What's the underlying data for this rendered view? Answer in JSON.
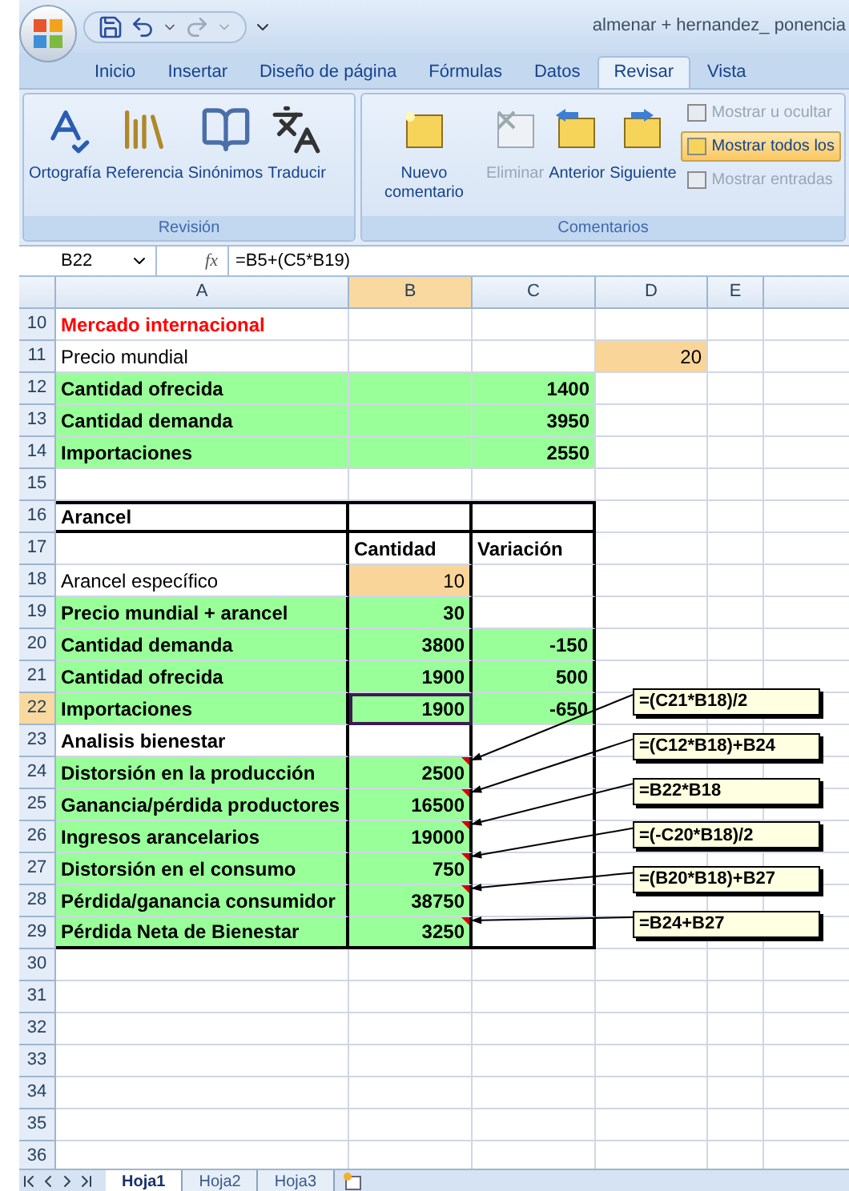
{
  "window": {
    "title": "almenar + hernandez_ ponencia"
  },
  "tabs": [
    {
      "label": "Inicio",
      "selected": false
    },
    {
      "label": "Insertar",
      "selected": false
    },
    {
      "label": "Diseño de página",
      "selected": false
    },
    {
      "label": "Fórmulas",
      "selected": false
    },
    {
      "label": "Datos",
      "selected": false
    },
    {
      "label": "Revisar",
      "selected": true
    },
    {
      "label": "Vista",
      "selected": false
    }
  ],
  "ribbon": {
    "groups": [
      {
        "label": "Revisión",
        "buttons": [
          {
            "kind": "spelling",
            "label": "Ortografía",
            "disabled": false
          },
          {
            "kind": "research",
            "label": "Referencia",
            "disabled": false
          },
          {
            "kind": "thesaurus",
            "label": "Sinónimos",
            "disabled": false
          },
          {
            "kind": "translate",
            "label": "Traducir",
            "disabled": false
          }
        ]
      },
      {
        "label": "Comentarios",
        "buttons": [
          {
            "kind": "new",
            "label": "Nuevo comentario",
            "disabled": false
          },
          {
            "kind": "delete",
            "label": "Eliminar",
            "disabled": true
          },
          {
            "kind": "previous",
            "label": "Anterior",
            "disabled": false
          },
          {
            "kind": "next",
            "label": "Siguiente",
            "disabled": false
          }
        ],
        "side_items": [
          {
            "label": "Mostrar u ocultar",
            "disabled": true,
            "on": false
          },
          {
            "label": "Mostrar todos los",
            "disabled": false,
            "on": true
          },
          {
            "label": "Mostrar entradas",
            "disabled": true,
            "on": false
          }
        ]
      }
    ]
  },
  "formula_bar": {
    "name_box": "B22",
    "fx": "fx",
    "formula": "=B5+(C5*B19)"
  },
  "columns": [
    {
      "label": "A",
      "selected": false
    },
    {
      "label": "B",
      "selected": true
    },
    {
      "label": "C",
      "selected": false
    },
    {
      "label": "D",
      "selected": false
    },
    {
      "label": "E",
      "selected": false
    }
  ],
  "rows": [
    {
      "number": "10",
      "selected": false,
      "kind": "section",
      "cells": [
        {
          "kind": "text",
          "text": "Mercado internacional"
        }
      ]
    },
    {
      "number": "11",
      "selected": false,
      "kind": "entry",
      "cells": [
        {
          "kind": "text",
          "text": "Precio mundial"
        },
        {},
        {},
        {
          "kind": "number",
          "text": "20",
          "color": "#fad59a"
        }
      ]
    },
    {
      "number": "12",
      "selected": false,
      "kind": "result",
      "cells": [
        {
          "kind": "text",
          "text": "Cantidad ofrecida",
          "color": "#99ff99"
        },
        {
          "kind": "number",
          "color": "#99ff99"
        },
        {
          "kind": "number",
          "text": "1400",
          "color": "#99ff99"
        }
      ]
    },
    {
      "number": "13",
      "selected": false,
      "kind": "result",
      "cells": [
        {
          "kind": "text",
          "text": "Cantidad demanda",
          "color": "#99ff99"
        },
        {
          "kind": "number",
          "color": "#99ff99"
        },
        {
          "kind": "number",
          "text": "3950",
          "color": "#99ff99"
        }
      ]
    },
    {
      "number": "14",
      "selected": false,
      "kind": "result",
      "cells": [
        {
          "kind": "text",
          "text": "Importaciones",
          "color": "#99ff99"
        },
        {
          "kind": "number",
          "color": "#99ff99"
        },
        {
          "kind": "number",
          "text": "2550",
          "color": "#99ff99"
        }
      ]
    },
    {
      "number": "15",
      "selected": false,
      "kind": "entry",
      "cells": []
    },
    {
      "number": "16",
      "selected": false,
      "kind": "result",
      "cells": [
        {
          "kind": "text",
          "text": "Arancel"
        }
      ]
    },
    {
      "number": "17",
      "selected": false,
      "kind": "result",
      "cells": [
        {},
        {
          "kind": "text",
          "text": "Cantidad"
        },
        {
          "kind": "text",
          "text": "Variación"
        }
      ]
    },
    {
      "number": "18",
      "selected": false,
      "kind": "entry",
      "cells": [
        {
          "kind": "text",
          "text": "Arancel específico"
        },
        {
          "kind": "number",
          "text": "10",
          "color": "#fad59a"
        }
      ]
    },
    {
      "number": "19",
      "selected": false,
      "kind": "result",
      "cells": [
        {
          "kind": "text",
          "text": "Precio mundial + arancel",
          "color": "#99ff99"
        },
        {
          "kind": "number",
          "text": "30",
          "color": "#99ff99"
        }
      ]
    },
    {
      "number": "20",
      "selected": false,
      "kind": "result",
      "cells": [
        {
          "kind": "text",
          "text": "Cantidad demanda",
          "color": "#99ff99"
        },
        {
          "kind": "number",
          "text": "3800",
          "color": "#99ff99"
        },
        {
          "kind": "number",
          "text": "-150",
          "color": "#99ff99"
        }
      ]
    },
    {
      "number": "21",
      "selected": false,
      "kind": "result",
      "cells": [
        {
          "kind": "text",
          "text": "Cantidad ofrecida",
          "color": "#99ff99"
        },
        {
          "kind": "number",
          "text": "1900",
          "color": "#99ff99"
        },
        {
          "kind": "number",
          "text": "500",
          "color": "#99ff99"
        }
      ]
    },
    {
      "number": "22",
      "selected": true,
      "kind": "result",
      "cells": [
        {
          "kind": "text",
          "text": "Importaciones",
          "color": "#99ff99"
        },
        {
          "kind": "number",
          "text": "1900",
          "color": "#99ff99"
        },
        {
          "kind": "number",
          "text": "-650",
          "color": "#99ff99"
        }
      ]
    },
    {
      "number": "23",
      "selected": false,
      "kind": "result",
      "cells": [
        {
          "kind": "text",
          "text": "Analisis bienestar"
        }
      ]
    },
    {
      "number": "24",
      "selected": false,
      "kind": "result",
      "cells": [
        {
          "kind": "text",
          "text": "Distorsión en la producción",
          "color": "#99ff99"
        },
        {
          "kind": "number",
          "text": "2500",
          "color": "#99ff99",
          "comment": "=(C21*B18)/2"
        }
      ]
    },
    {
      "number": "25",
      "selected": false,
      "kind": "result",
      "cells": [
        {
          "kind": "text",
          "text": "Ganancia/pérdida productores",
          "color": "#99ff99"
        },
        {
          "kind": "number",
          "text": "16500",
          "color": "#99ff99",
          "comment": "=(C12*B18)+B24"
        }
      ]
    },
    {
      "number": "26",
      "selected": false,
      "kind": "result",
      "cells": [
        {
          "kind": "text",
          "text": "Ingresos arancelarios",
          "color": "#99ff99"
        },
        {
          "kind": "number",
          "text": "19000",
          "color": "#99ff99",
          "comment": "=B22*B18"
        }
      ]
    },
    {
      "number": "27",
      "selected": false,
      "kind": "result",
      "cells": [
        {
          "kind": "text",
          "text": "Distorsión en el consumo",
          "color": "#99ff99"
        },
        {
          "kind": "number",
          "text": "750",
          "color": "#99ff99",
          "comment": "=(-C20*B18)/2"
        }
      ]
    },
    {
      "number": "28",
      "selected": false,
      "kind": "result",
      "cells": [
        {
          "kind": "text",
          "text": "Pérdida/ganancia consumidor",
          "color": "#99ff99"
        },
        {
          "kind": "number",
          "text": "38750",
          "color": "#99ff99",
          "comment": "=(B20*B18)+B27"
        }
      ]
    },
    {
      "number": "29",
      "selected": false,
      "kind": "result",
      "cells": [
        {
          "kind": "text",
          "text": "Pérdida Neta de Bienestar",
          "color": "#99ff99"
        },
        {
          "kind": "number",
          "text": "3250",
          "color": "#99ff99",
          "comment": "=B24+B27"
        }
      ]
    },
    {
      "number": "30",
      "selected": false,
      "kind": "entry",
      "cells": []
    },
    {
      "number": "31",
      "selected": false,
      "kind": "entry",
      "cells": []
    },
    {
      "number": "32",
      "selected": false,
      "kind": "entry",
      "cells": []
    },
    {
      "number": "33",
      "selected": false,
      "kind": "entry",
      "cells": []
    },
    {
      "number": "34",
      "selected": false,
      "kind": "entry",
      "cells": []
    },
    {
      "number": "35",
      "selected": false,
      "kind": "entry",
      "cells": []
    },
    {
      "number": "36",
      "selected": false,
      "kind": "entry",
      "cells": []
    }
  ],
  "sheet_tabs": [
    {
      "label": "Hoja1",
      "selected": true
    },
    {
      "label": "Hoja2",
      "selected": false
    },
    {
      "label": "Hoja3",
      "selected": false
    }
  ]
}
